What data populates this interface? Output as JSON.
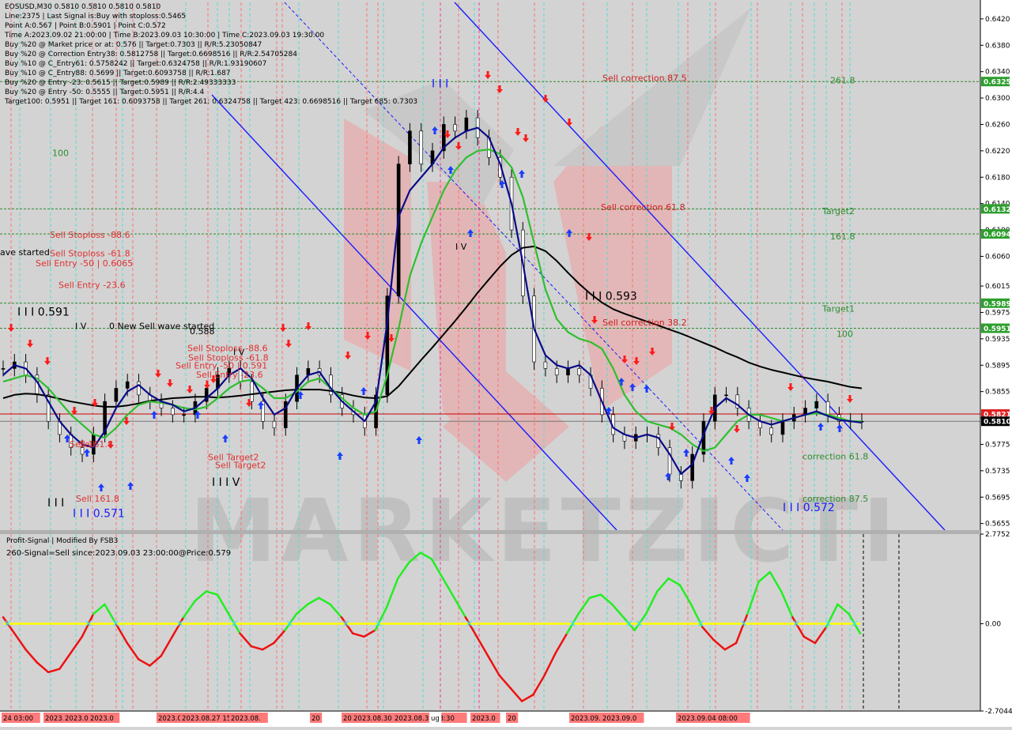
{
  "header": {
    "symbol_line": "EOSUSD,M30  0.5810 0.5810 0.5810 0.5810",
    "info_lines": [
      "Line:2375 | Last Signal is:Buy with stoploss:0.5465",
      "Point A:0.567 | Point B:0.5901 | Point C:0.572",
      "Time A:2023.09.02 21:00:00 | Time B:2023.09.03 10:30:00 | Time C:2023.09.03 19:30:00",
      "Buy %20 @ Market price or at: 0.576 || Target:0.7303 || R/R:5.23050847",
      "Buy %20 @ Correction Entry38: 0.5812758 || Target:0.6698516 || R/R:2.54705284",
      "Buy %10 @ C_Entry61: 0.5758242 || Target:0.6324758 || R/R:1.93190607",
      "Buy %10 @ C_Entry88: 0.5699 || Target:0.6093758 || R/R:1.687",
      "Buy %20 @ Entry -23: 0.5615 || Target:0.5989 || R/R:2.49333333",
      "Buy %20 @ Entry -50: 0.5555 || Target:0.5951 || R/R:4.4",
      "Target100: 0.5951 || Target 161: 0.6093758 || Target 261: 0.6324758 || Target 423: 0.6698516 || Target 685: 0.7303"
    ]
  },
  "chart_data": [
    {
      "type": "line",
      "symbol": "EOSUSD",
      "timeframe": "M30",
      "ylim": [
        0.5645,
        0.6445
      ],
      "y_ticks": [
        "0.6420",
        "0.6380",
        "0.6340",
        "0.6300",
        "0.6260",
        "0.6220",
        "0.6180",
        "0.6140",
        "0.6100",
        "0.6060",
        "0.6015",
        "0.5975",
        "0.5935",
        "0.5895",
        "0.5855",
        "0.5815",
        "0.5775",
        "0.5735",
        "0.5695",
        "0.5655"
      ],
      "price_tags": [
        {
          "value": 0.6325,
          "label": "0.6325",
          "color": "#2e9e2e",
          "line_color": "#2e8b2e"
        },
        {
          "value": 0.6132,
          "label": "0.6132",
          "color": "#2e9e2e",
          "line_color": "#2e8b2e"
        },
        {
          "value": 0.6094,
          "label": "0.6094",
          "color": "#2e9e2e",
          "line_color": "#2e8b2e"
        },
        {
          "value": 0.5989,
          "label": "0.5989",
          "color": "#2e9e2e",
          "line_color": "#2e8b2e"
        },
        {
          "value": 0.5951,
          "label": "0.5951",
          "color": "#2e9e2e",
          "line_color": "#2e8b2e"
        },
        {
          "value": 0.5821,
          "label": "0.5821",
          "color": "#e02020",
          "line_color": "#cc0000"
        },
        {
          "value": 0.581,
          "label": "0.5810",
          "color": "#000000",
          "line_color": "#777777"
        }
      ],
      "ma_black": [
        0.5845,
        0.585,
        0.5852,
        0.5851,
        0.5848,
        0.5844,
        0.584,
        0.5837,
        0.5834,
        0.5832,
        0.5832,
        0.5834,
        0.5837,
        0.5841,
        0.5843,
        0.5845,
        0.5846,
        0.5847,
        0.5847,
        0.5846,
        0.5847,
        0.5849,
        0.5851,
        0.5853,
        0.5855,
        0.5857,
        0.5858,
        0.5858,
        0.5858,
        0.5856,
        0.5853,
        0.5849,
        0.5846,
        0.5845,
        0.5848,
        0.5863,
        0.5883,
        0.5903,
        0.5922,
        0.5942,
        0.5962,
        0.5983,
        0.6005,
        0.6025,
        0.6045,
        0.6062,
        0.6073,
        0.6075,
        0.6068,
        0.6053,
        0.6035,
        0.6018,
        0.6003,
        0.599,
        0.598,
        0.5973,
        0.5967,
        0.5961,
        0.5955,
        0.5949,
        0.5943,
        0.5936,
        0.5929,
        0.5922,
        0.5914,
        0.5907,
        0.5899,
        0.5893,
        0.5888,
        0.5884,
        0.588,
        0.5876,
        0.5873,
        0.587,
        0.5866,
        0.5862,
        0.586
      ],
      "ma_green": [
        0.587,
        0.5875,
        0.588,
        0.5875,
        0.586,
        0.584,
        0.582,
        0.5805,
        0.579,
        0.5785,
        0.58,
        0.582,
        0.5835,
        0.584,
        0.5838,
        0.5835,
        0.583,
        0.5828,
        0.5832,
        0.5845,
        0.586,
        0.587,
        0.5873,
        0.586,
        0.5845,
        0.5845,
        0.5855,
        0.587,
        0.5875,
        0.586,
        0.5845,
        0.583,
        0.582,
        0.5825,
        0.588,
        0.595,
        0.603,
        0.608,
        0.612,
        0.616,
        0.619,
        0.621,
        0.622,
        0.6222,
        0.6215,
        0.6195,
        0.615,
        0.608,
        0.601,
        0.5965,
        0.5945,
        0.5935,
        0.593,
        0.592,
        0.589,
        0.585,
        0.5825,
        0.581,
        0.5805,
        0.58,
        0.579,
        0.5775,
        0.5765,
        0.577,
        0.579,
        0.581,
        0.582,
        0.582,
        0.5815,
        0.581,
        0.5815,
        0.582,
        0.5822,
        0.582,
        0.5815,
        0.581,
        0.581
      ],
      "ma_navy": [
        0.588,
        0.5895,
        0.589,
        0.587,
        0.584,
        0.581,
        0.579,
        0.5775,
        0.577,
        0.5795,
        0.583,
        0.5855,
        0.5865,
        0.585,
        0.584,
        0.5835,
        0.5825,
        0.583,
        0.5845,
        0.586,
        0.588,
        0.589,
        0.5875,
        0.5845,
        0.582,
        0.583,
        0.586,
        0.588,
        0.5885,
        0.586,
        0.584,
        0.5825,
        0.581,
        0.584,
        0.596,
        0.612,
        0.616,
        0.618,
        0.62,
        0.6225,
        0.624,
        0.625,
        0.6255,
        0.624,
        0.62,
        0.614,
        0.605,
        0.595,
        0.591,
        0.5895,
        0.589,
        0.5895,
        0.588,
        0.584,
        0.58,
        0.579,
        0.5785,
        0.579,
        0.5785,
        0.576,
        0.573,
        0.5745,
        0.579,
        0.583,
        0.5845,
        0.5835,
        0.582,
        0.581,
        0.5805,
        0.581,
        0.5815,
        0.582,
        0.5825,
        0.5818,
        0.5812,
        0.581,
        0.5808
      ],
      "close": [
        0.589,
        0.59,
        0.588,
        0.585,
        0.581,
        0.579,
        0.577,
        0.576,
        0.579,
        0.584,
        0.586,
        0.587,
        0.585,
        0.584,
        0.583,
        0.582,
        0.582,
        0.584,
        0.586,
        0.588,
        0.589,
        0.587,
        0.584,
        0.581,
        0.58,
        0.584,
        0.588,
        0.589,
        0.588,
        0.585,
        0.583,
        0.582,
        0.58,
        0.585,
        0.6,
        0.62,
        0.625,
        0.62,
        0.622,
        0.626,
        0.625,
        0.627,
        0.624,
        0.621,
        0.618,
        0.61,
        0.6,
        0.59,
        0.589,
        0.588,
        0.589,
        0.588,
        0.586,
        0.582,
        0.579,
        0.578,
        0.579,
        0.579,
        0.577,
        0.573,
        0.572,
        0.576,
        0.581,
        0.585,
        0.585,
        0.583,
        0.581,
        0.58,
        0.579,
        0.581,
        0.582,
        0.583,
        0.584,
        0.582,
        0.581,
        0.581,
        0.581
      ],
      "labels": [
        {
          "text": "261.8",
          "value": 0.6322,
          "color": "#2e8b2e"
        },
        {
          "text": "Sell correction 87.5",
          "value": 0.6326,
          "color": "#cc2020"
        },
        {
          "text": "100",
          "value": 0.6212,
          "color": "#2e8b2e"
        },
        {
          "text": "Sell Stoploss -88.6",
          "value": 0.6088,
          "color": "#e03030"
        },
        {
          "text": "Sell correction 61.8",
          "value": 0.613,
          "color": "#cc2020"
        },
        {
          "text": "Target2",
          "value": 0.6124,
          "color": "#2e8b2e"
        },
        {
          "text": "161.8",
          "value": 0.6086,
          "color": "#2e8b2e"
        },
        {
          "text": "ave started",
          "value": 0.6062,
          "color": "#000000"
        },
        {
          "text": "Sell Stoploss -61.8",
          "value": 0.606,
          "color": "#e03030"
        },
        {
          "text": "Sell Entry -50 | 0.6065",
          "value": 0.6045,
          "color": "#e03030"
        },
        {
          "text": "Sell Entry -23.6",
          "value": 0.6012,
          "color": "#e03030"
        },
        {
          "text": "I I I 0.593",
          "value": 0.5994,
          "color": "#000000"
        },
        {
          "text": "I I I 0.591",
          "value": 0.597,
          "color": "#000000"
        },
        {
          "text": "Target1",
          "value": 0.5976,
          "color": "#2e8b2e"
        },
        {
          "text": "Sell correction 38.2",
          "value": 0.5955,
          "color": "#cc2020"
        },
        {
          "text": "I V",
          "value": 0.595,
          "color": "#000000"
        },
        {
          "text": "0 New Sell wave started",
          "value": 0.595,
          "color": "#000000"
        },
        {
          "text": "0.588",
          "value": 0.5942,
          "color": "#000000"
        },
        {
          "text": "100",
          "value": 0.5938,
          "color": "#2e8b2e"
        },
        {
          "text": "Sell Stoploss -88.6",
          "value": 0.5916,
          "color": "#e03030"
        },
        {
          "text": "I V",
          "value": 0.591,
          "color": "#000000"
        },
        {
          "text": "Sell Stoploss -61.8",
          "value": 0.5902,
          "color": "#e03030"
        },
        {
          "text": "Sell Entry -50 | 0.591",
          "value": 0.589,
          "color": "#e03030"
        },
        {
          "text": "Sell Entry -23.6",
          "value": 0.5876,
          "color": "#e03030"
        },
        {
          "text": "Sell",
          "value": 0.5771,
          "color": "#e03030"
        },
        {
          "text": "Sell 161.8",
          "value": 0.5771,
          "color": "#e03030"
        },
        {
          "text": "Sell Target2",
          "value": 0.5751,
          "color": "#e03030"
        },
        {
          "text": "Sell Target2",
          "value": 0.5739,
          "color": "#e03030"
        },
        {
          "text": "correction 61.8",
          "value": 0.5752,
          "color": "#2e8b2e"
        },
        {
          "text": "I I I V",
          "value": 0.5712,
          "color": "#000000"
        },
        {
          "text": "I I I",
          "value": 0.5681,
          "color": "#000000"
        },
        {
          "text": "Sell 161.8",
          "value": 0.5688,
          "color": "#e03030"
        },
        {
          "text": "correction 87.5",
          "value": 0.5688,
          "color": "#2e8b2e"
        },
        {
          "text": "I I I 0.572",
          "value": 0.5674,
          "color": "#1a1aff"
        },
        {
          "text": "I I I 0.571",
          "value": 0.5665,
          "color": "#1a1aff"
        },
        {
          "text": "I V",
          "value": 0.607,
          "color": "#000000"
        },
        {
          "text": "I I I",
          "value": 0.6316,
          "color": "#1a1aff"
        }
      ]
    },
    {
      "type": "line",
      "title": "Profit-Signal | Modified By FSB3",
      "subtitle": "260-Signal=Sell since:2023.09.03 23:00:00@Price:0.579",
      "ylim": [
        -2.7044,
        2.7752
      ],
      "y_ticks": [
        "2.7752",
        "0.00",
        "-2.7044"
      ],
      "zero_line_color": "#ffff00",
      "values": [
        0.2,
        -0.3,
        -0.8,
        -1.2,
        -1.5,
        -1.4,
        -0.9,
        -0.4,
        0.3,
        0.6,
        0.0,
        -0.6,
        -1.1,
        -1.3,
        -1.0,
        -0.4,
        0.2,
        0.7,
        1.0,
        0.9,
        0.3,
        -0.3,
        -0.7,
        -0.8,
        -0.6,
        -0.2,
        0.3,
        0.6,
        0.8,
        0.6,
        0.2,
        -0.3,
        -0.4,
        -0.2,
        0.5,
        1.4,
        1.9,
        2.2,
        2.0,
        1.4,
        0.8,
        0.2,
        -0.4,
        -1.0,
        -1.6,
        -2.0,
        -2.4,
        -2.2,
        -1.6,
        -0.9,
        -0.3,
        0.3,
        0.8,
        0.9,
        0.6,
        0.2,
        -0.2,
        0.3,
        1.0,
        1.4,
        1.2,
        0.6,
        -0.1,
        -0.5,
        -0.8,
        -0.6,
        0.3,
        1.3,
        1.6,
        1.0,
        0.2,
        -0.4,
        -0.6,
        -0.1,
        0.6,
        0.3,
        -0.3
      ]
    }
  ],
  "x_axis": {
    "labels": [
      "24 03:00",
      "2023.0",
      "2023.08.25 1",
      "2023.0",
      "2023.08.2",
      "2023.08.27 15:0",
      "2023.08.",
      "20",
      "2023.0",
      "2023.08.30 10",
      "2023.08.31 03:30",
      "ug",
      "2023.0",
      "20",
      "2023.09.02",
      "2023.09.0",
      "2023.09.04 08:00"
    ]
  },
  "watermark": "MARKETZICTI"
}
